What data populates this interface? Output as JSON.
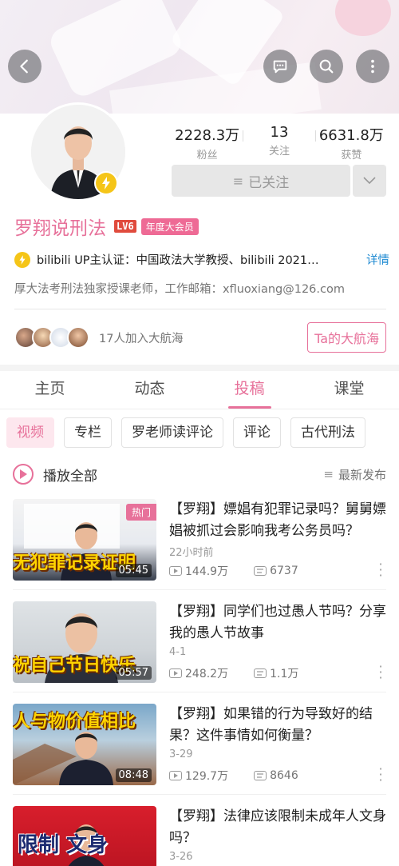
{
  "header": {
    "back_icon": "chevron-left-icon",
    "actions": [
      "chat-icon",
      "search-icon",
      "more-vertical-icon"
    ]
  },
  "profile": {
    "stats": [
      {
        "value": "2228.3万",
        "label": "粉丝"
      },
      {
        "value": "13",
        "label": "关注"
      },
      {
        "value": "6631.8万",
        "label": "获赞"
      }
    ],
    "follow_label": "已关注",
    "name": "罗翔说刑法",
    "level": "LV6",
    "vip_badge": "年度大会员",
    "certification": "bilibili UP主认证：中国政法大学教授、bilibili 2021…",
    "cert_detail": "详情",
    "sign": "厚大法考刑法独家授课老师，工作邮箱：xfluoxiang@126.com",
    "fleet_text": "17人加入大航海",
    "fleet_button": "Ta的大航海"
  },
  "tabs": [
    {
      "label": "主页",
      "active": false
    },
    {
      "label": "动态",
      "active": false
    },
    {
      "label": "投稿",
      "active": true
    },
    {
      "label": "课堂",
      "active": false
    }
  ],
  "chips": [
    {
      "label": "视频",
      "active": true
    },
    {
      "label": "专栏",
      "active": false
    },
    {
      "label": "罗老师读评论",
      "active": false
    },
    {
      "label": "评论",
      "active": false
    },
    {
      "label": "古代刑法",
      "active": false
    }
  ],
  "list_header": {
    "play_all": "播放全部",
    "sort": "最新发布"
  },
  "videos": [
    {
      "title": "【罗翔】嫖娼有犯罪记录吗？舅舅嫖娼被抓过会影响我考公务员吗？",
      "time": "22小时前",
      "views": "144.9万",
      "danmaku": "6737",
      "duration": "05:45",
      "caption": "无犯罪记录证明",
      "hot": "热门"
    },
    {
      "title": "【罗翔】同学们也过愚人节吗？分享我的愚人节故事",
      "time": "4-1",
      "views": "248.2万",
      "danmaku": "1.1万",
      "duration": "05:57",
      "caption": "祝自己节日快乐",
      "hot": ""
    },
    {
      "title": "【罗翔】如果错的行为导致好的结果？这件事情如何衡量？",
      "time": "3-29",
      "views": "129.7万",
      "danmaku": "8646",
      "duration": "08:48",
      "caption": "人与物价值相比",
      "hot": ""
    },
    {
      "title": "【罗翔】法律应该限制未成年人文身吗？",
      "time": "3-26",
      "views": "",
      "danmaku": "",
      "duration": "",
      "caption": "限制 文身",
      "hot": ""
    }
  ]
}
